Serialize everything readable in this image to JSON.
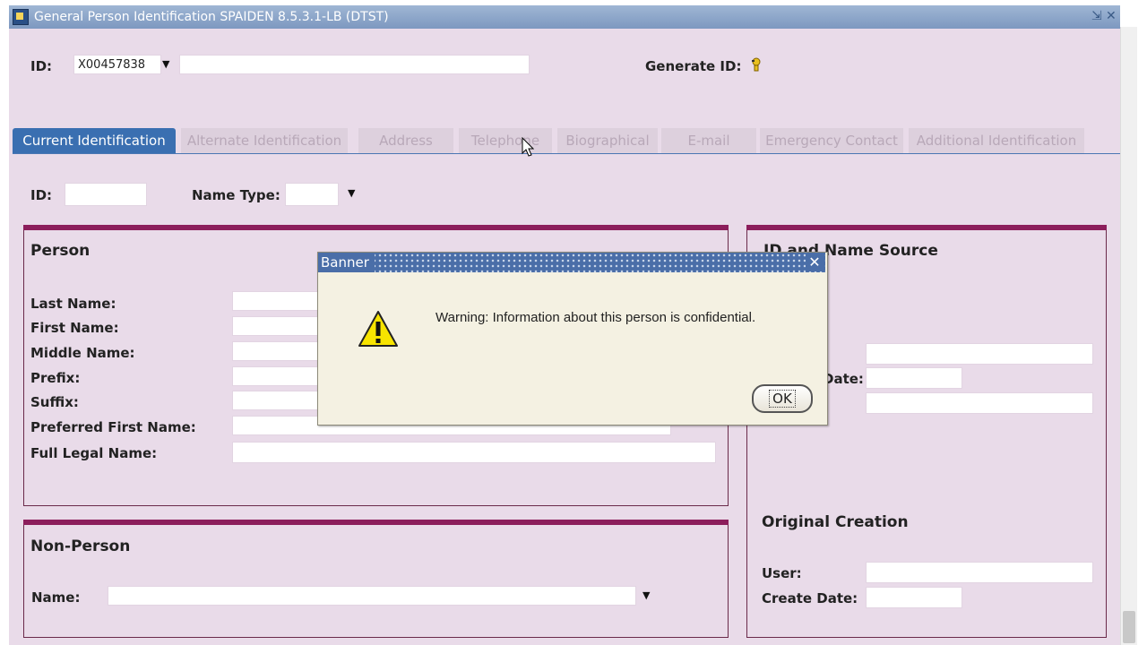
{
  "window": {
    "title": "General Person Identification  SPAIDEN  8.5.3.1-LB  (DTST)",
    "title_controls": [
      "⇲",
      "✕"
    ]
  },
  "key_block": {
    "id_label": "ID:",
    "id_value": "X00457838",
    "name_value": "",
    "generate_label": "Generate ID:"
  },
  "tabs": [
    {
      "label": "Current Identification",
      "active": true
    },
    {
      "label": "Alternate Identification",
      "active": false
    },
    {
      "label": "Address",
      "active": false
    },
    {
      "label": "Telephone",
      "active": false
    },
    {
      "label": "Biographical",
      "active": false
    },
    {
      "label": "E-mail",
      "active": false
    },
    {
      "label": "Emergency Contact",
      "active": false
    },
    {
      "label": "Additional Identification",
      "active": false
    }
  ],
  "current": {
    "id_label": "ID:",
    "name_type_label": "Name Type:"
  },
  "person": {
    "heading": "Person",
    "fields": [
      {
        "label": "Last Name:",
        "value": ""
      },
      {
        "label": "First Name:",
        "value": ""
      },
      {
        "label": "Middle Name:",
        "value": ""
      },
      {
        "label": "Prefix:",
        "value": ""
      },
      {
        "label": "Suffix:",
        "value": ""
      },
      {
        "label": "Preferred First Name:",
        "value": ""
      },
      {
        "label": "Full Legal Name:",
        "value": ""
      }
    ]
  },
  "non_person": {
    "heading": "Non-Person",
    "name_label": "Name:"
  },
  "source": {
    "heading_visible": "ID and Name Source",
    "last_update_visible": "odate",
    "date_label_visible": "Date:",
    "original_creation": "Original Creation",
    "user_label": "User:",
    "create_date_label": "Create Date:"
  },
  "dialog": {
    "title": "Banner",
    "close_icon": "✕",
    "message": "Warning: Information about this person is confidential.",
    "ok_label": "OK",
    "icon": "warning-icon"
  },
  "colors": {
    "panel_bar": "#8c1e5c",
    "active_tab": "#3a6fb1",
    "form_bg": "#e9dbe9"
  }
}
